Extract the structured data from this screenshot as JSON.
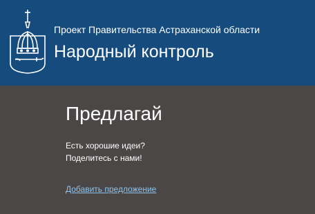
{
  "header": {
    "subtitle": "Проект Правительства Астраханской области",
    "title": "Народный контроль",
    "logo_icon": "astrakhan-crown-emblem-icon",
    "background_color": "#154b7d"
  },
  "main": {
    "heading": "Предлагай",
    "text_line1": "Есть хорошие идеи?",
    "text_line2": "Поделитесь с нами!",
    "link_label": "Добавить предложение",
    "background_color": "#4a4746",
    "link_color": "#8fc3ec"
  }
}
